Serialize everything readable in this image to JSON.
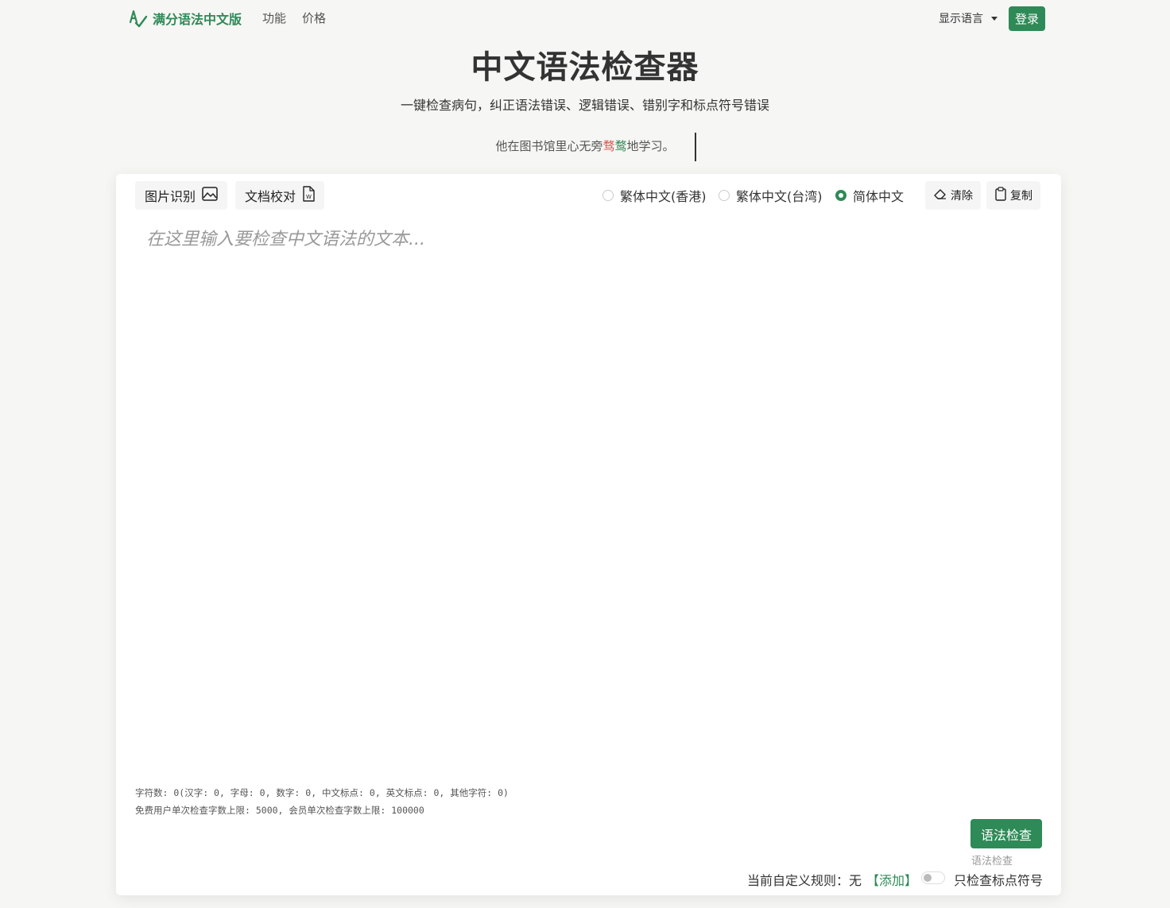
{
  "nav": {
    "brand": "满分语法中文版",
    "links": [
      "功能",
      "价格"
    ],
    "language_label": "显示语言",
    "login": "登录"
  },
  "hero": {
    "title": "中文语法检查器",
    "subtitle": "一键检查病句，纠正语法错误、逻辑错误、错别字和标点符号错误",
    "demo": {
      "before": "他在图书馆里心无旁",
      "err1": "骛",
      "err2": "鹜",
      "after": "地学习。"
    }
  },
  "toolbar": {
    "image_ocr": "图片识别",
    "doc_check": "文档校对",
    "radios": [
      {
        "label": "繁体中文(香港)",
        "checked": false
      },
      {
        "label": "繁体中文(台湾)",
        "checked": false
      },
      {
        "label": "简体中文",
        "checked": true
      }
    ],
    "clear": "清除",
    "copy": "复制"
  },
  "editor": {
    "placeholder": "在这里输入要检查中文语法的文本...",
    "value": ""
  },
  "stats": {
    "line1": "字符数: 0(汉字: 0, 字母: 0, 数字: 0, 中文标点: 0, 英文标点: 0, 其他字符: 0)",
    "line2": "免费用户单次检查字数上限: 5000, 会员单次检查字数上限: 100000"
  },
  "actions": {
    "check": "语法检查",
    "check_caption": "语法检查",
    "rules_prefix": "当前自定义规则：无",
    "add": "【添加】",
    "punct_only": "只检查标点符号",
    "punct_only_on": false
  },
  "colors": {
    "accent": "#2e8a57",
    "error": "#d9534f"
  }
}
